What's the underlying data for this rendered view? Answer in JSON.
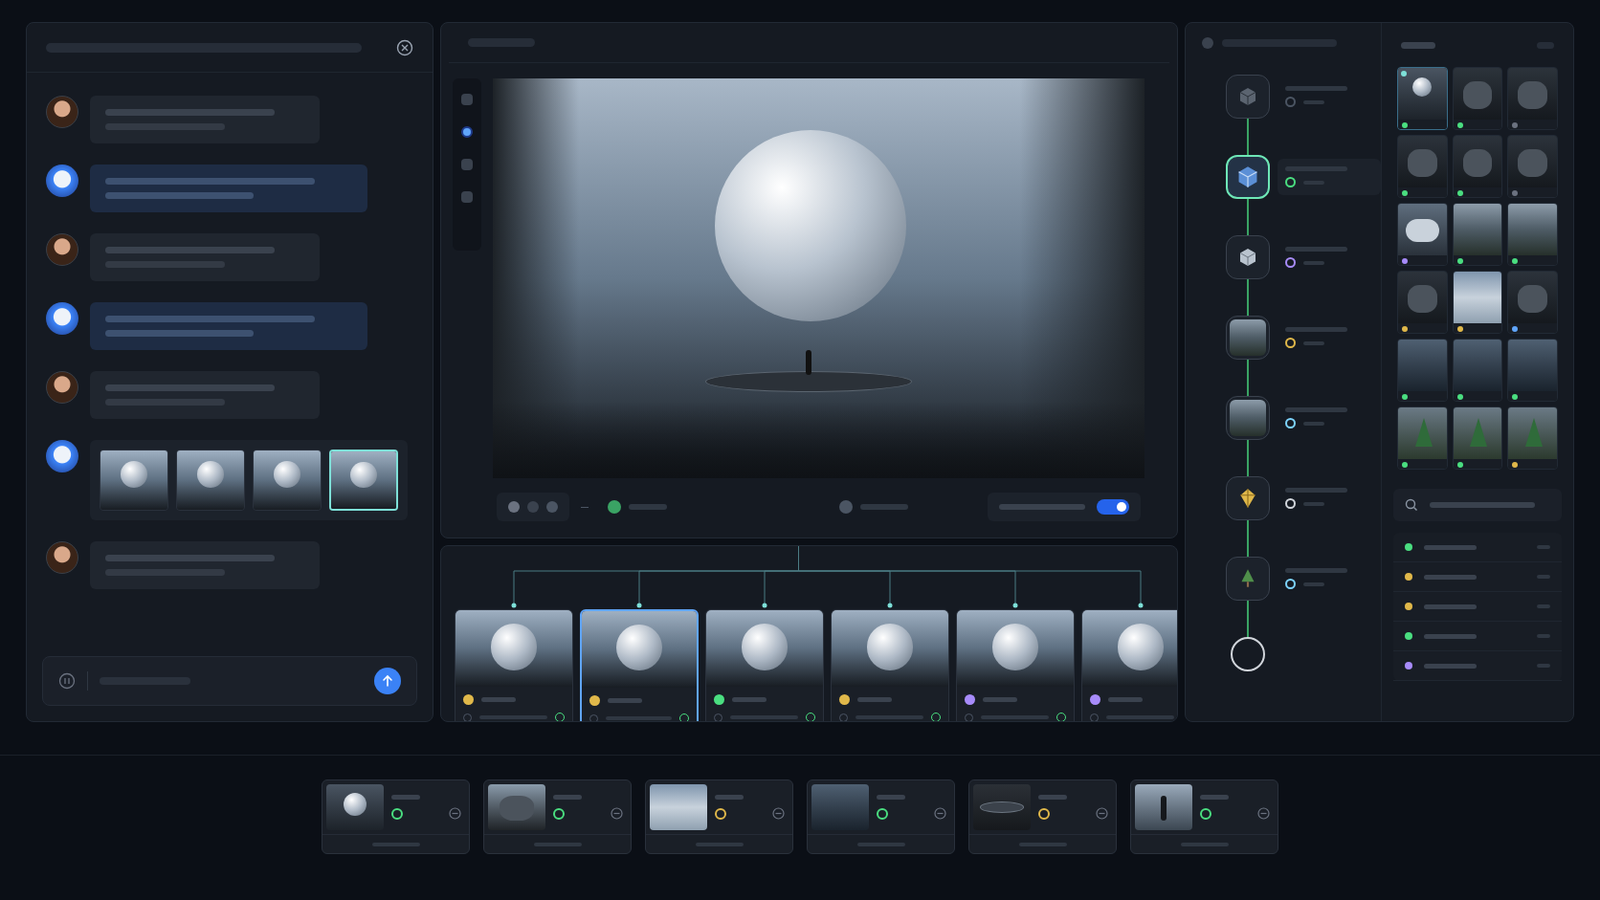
{
  "chat": {
    "messages": [
      {
        "role": "user",
        "kind": "text"
      },
      {
        "role": "assistant",
        "kind": "text"
      },
      {
        "role": "user",
        "kind": "text"
      },
      {
        "role": "assistant",
        "kind": "text"
      },
      {
        "role": "user",
        "kind": "text"
      },
      {
        "role": "assistant",
        "kind": "images",
        "images": [
          {
            "selected": false
          },
          {
            "selected": false
          },
          {
            "selected": false
          },
          {
            "selected": true
          }
        ]
      },
      {
        "role": "user",
        "kind": "text"
      }
    ]
  },
  "viewer": {
    "tools": [
      {
        "selected": false
      },
      {
        "selected": true
      },
      {
        "selected": false
      },
      {
        "selected": false
      }
    ],
    "toggle": {
      "on": true
    }
  },
  "variants": [
    {
      "color": "#e0b84a",
      "selected": false
    },
    {
      "color": "#e0b84a",
      "selected": true
    },
    {
      "color": "#4ade80",
      "selected": false
    },
    {
      "color": "#e0b84a",
      "selected": false
    },
    {
      "color": "#a78bfa",
      "selected": false
    },
    {
      "color": "#a78bfa",
      "selected": false
    }
  ],
  "pipeline": {
    "nodes": [
      {
        "kind": "cube-dark",
        "color": "#4b5563",
        "selected": false
      },
      {
        "kind": "cube-blue",
        "color": "#4ade80",
        "selected": true
      },
      {
        "kind": "cube-light",
        "color": "#a78bfa",
        "selected": false
      },
      {
        "kind": "landscape",
        "color": "#e0b84a",
        "selected": false
      },
      {
        "kind": "lake",
        "color": "#7dd3fc",
        "selected": false
      },
      {
        "kind": "gem",
        "color": "#d1d5db",
        "selected": false
      },
      {
        "kind": "tree",
        "color": "#7dd3fc",
        "selected": false
      }
    ]
  },
  "assets": {
    "items": [
      {
        "kind": "sphere",
        "color": "#4ade80",
        "selected": true
      },
      {
        "kind": "rock",
        "color": "#4ade80",
        "selected": false
      },
      {
        "kind": "rock",
        "color": "#6b7280",
        "selected": false
      },
      {
        "kind": "rock",
        "color": "#4ade80",
        "selected": false
      },
      {
        "kind": "rock",
        "color": "#4ade80",
        "selected": false
      },
      {
        "kind": "rock",
        "color": "#6b7280",
        "selected": false
      },
      {
        "kind": "cloud",
        "color": "#a78bfa",
        "selected": false
      },
      {
        "kind": "landscape",
        "color": "#4ade80",
        "selected": false
      },
      {
        "kind": "landscape",
        "color": "#4ade80",
        "selected": false
      },
      {
        "kind": "rock",
        "color": "#e0b84a",
        "selected": false
      },
      {
        "kind": "sky",
        "color": "#e0b84a",
        "selected": false
      },
      {
        "kind": "rock",
        "color": "#60a5fa",
        "selected": false
      },
      {
        "kind": "water",
        "color": "#4ade80",
        "selected": false
      },
      {
        "kind": "water",
        "color": "#4ade80",
        "selected": false
      },
      {
        "kind": "water",
        "color": "#4ade80",
        "selected": false
      },
      {
        "kind": "tree",
        "color": "#4ade80",
        "selected": false
      },
      {
        "kind": "tree",
        "color": "#4ade80",
        "selected": false
      },
      {
        "kind": "tree",
        "color": "#e0b84a",
        "selected": false
      }
    ]
  },
  "layers": [
    {
      "color": "#4ade80"
    },
    {
      "color": "#e0b84a"
    },
    {
      "color": "#e0b84a"
    },
    {
      "color": "#4ade80"
    },
    {
      "color": "#a78bfa"
    }
  ],
  "elements": [
    {
      "kind": "sphere",
      "color": "#4ade80"
    },
    {
      "kind": "cliff",
      "color": "#4ade80"
    },
    {
      "kind": "sky",
      "color": "#e0b84a"
    },
    {
      "kind": "water",
      "color": "#4ade80"
    },
    {
      "kind": "platform",
      "color": "#e0b84a"
    },
    {
      "kind": "figure",
      "color": "#4ade80"
    }
  ]
}
